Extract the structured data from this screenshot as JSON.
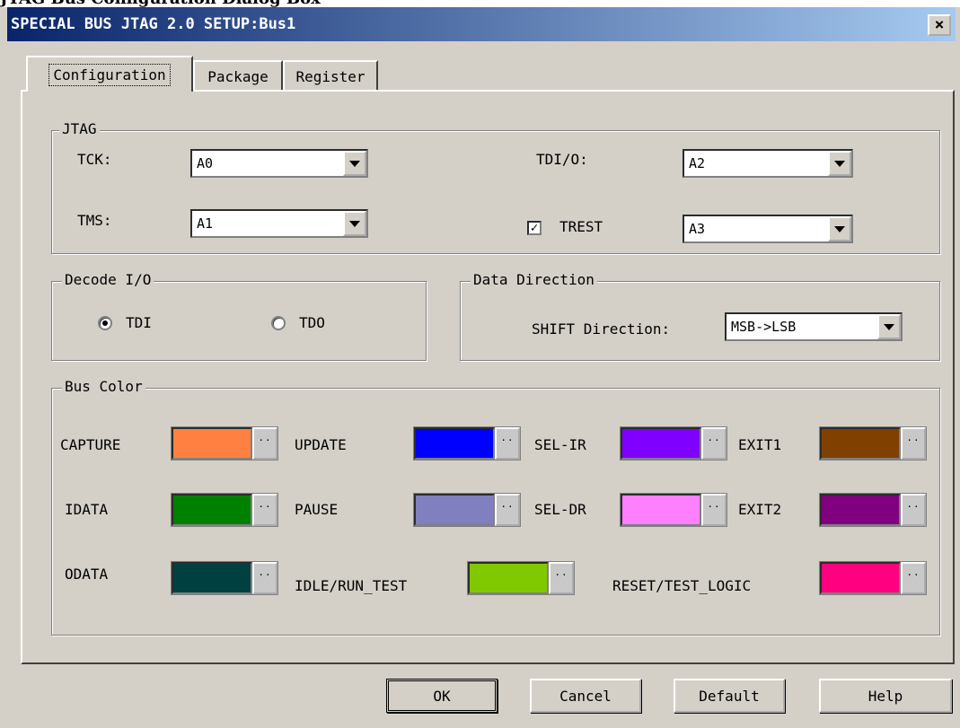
{
  "window": {
    "top_strip_text": "JTAG Bus Configuration Dialog Box",
    "title": "SPECIAL BUS JTAG 2.0 SETUP:Bus1",
    "close_glyph": "×"
  },
  "tabs": [
    {
      "label": "Configuration",
      "active": true
    },
    {
      "label": "Package",
      "active": false
    },
    {
      "label": "Register",
      "active": false
    }
  ],
  "jtag": {
    "title": "JTAG",
    "tck_label": "TCK:",
    "tck_value": "A0",
    "tms_label": "TMS:",
    "tms_value": "A1",
    "tdio_label": "TDI/O:",
    "tdio_value": "A2",
    "trest_label": "TREST",
    "trest_checked": true,
    "trest_value": "A3"
  },
  "decode": {
    "title": "Decode I/O",
    "tdi_label": "TDI",
    "tdo_label": "TDO",
    "selected": "TDI"
  },
  "direction": {
    "title": "Data Direction",
    "shift_label": "SHIFT Direction:",
    "shift_value": "MSB->LSB"
  },
  "bus_color": {
    "title": "Bus Color",
    "dots": "··",
    "capture": {
      "label": "CAPTURE",
      "color": "#ff8040"
    },
    "idata": {
      "label": "IDATA",
      "color": "#008000"
    },
    "odata": {
      "label": "ODATA",
      "color": "#004040"
    },
    "update": {
      "label": "UPDATE",
      "color": "#0000ff"
    },
    "pause": {
      "label": "PAUSE",
      "color": "#8080c0"
    },
    "idle": {
      "label": "IDLE/RUN_TEST",
      "color": "#80c800"
    },
    "selir": {
      "label": "SEL-IR",
      "color": "#8000ff"
    },
    "seldr": {
      "label": "SEL-DR",
      "color": "#ff80ff"
    },
    "reset": {
      "label": "RESET/TEST_LOGIC",
      "color": "#ff0080"
    },
    "exit1": {
      "label": "EXIT1",
      "color": "#804000"
    },
    "exit2": {
      "label": "EXIT2",
      "color": "#800080"
    }
  },
  "buttons": {
    "ok": "OK",
    "cancel": "Cancel",
    "default": "Default",
    "help": "Help"
  }
}
